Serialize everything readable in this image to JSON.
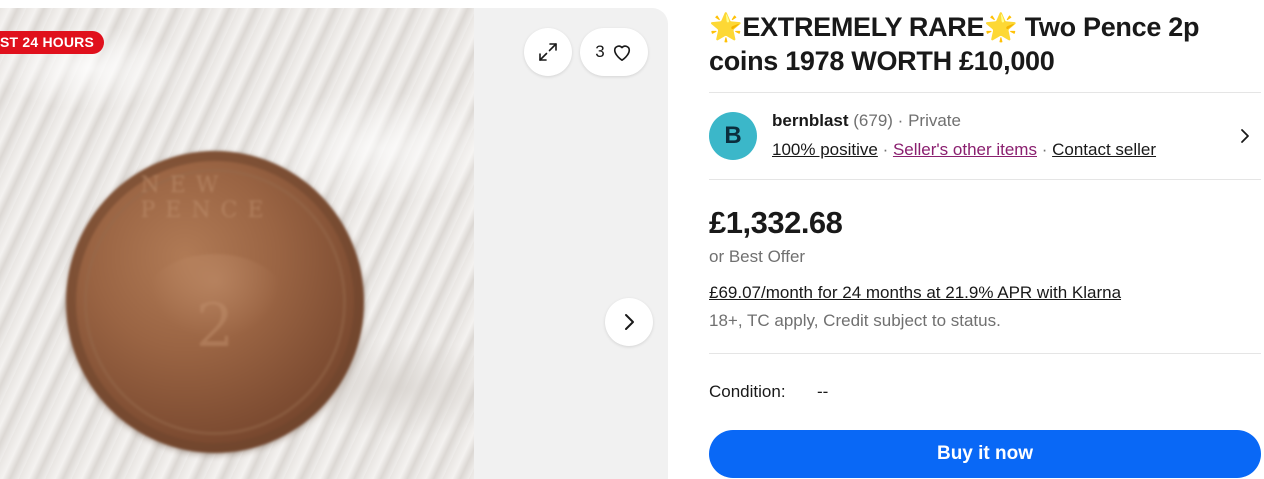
{
  "gallery": {
    "badge": "ST 24 HOURS",
    "watch_count": "3",
    "icons": {
      "expand": "expand-icon",
      "heart": "heart-icon",
      "next": "chevron-right-icon"
    }
  },
  "listing": {
    "title_prefix_emoji": "🌟",
    "title_rare": "EXTREMELY RARE",
    "title_suffix_emoji": "🌟",
    "title_rest": " Two Pence 2p coins 1978 WORTH £10,000"
  },
  "seller": {
    "avatar_letter": "B",
    "avatar_color": "#3bb7c9",
    "name": "bernblast",
    "feedback_count": "(679)",
    "separator": " · ",
    "type": "Private",
    "positive": "100% positive",
    "other_items": "Seller's other items",
    "contact": "Contact seller"
  },
  "pricing": {
    "price": "£1,332.68",
    "best_offer": "or Best Offer",
    "klarna": "£69.07/month for 24 months at 21.9% APR with Klarna",
    "terms": "18+, TC apply, Credit subject to status."
  },
  "condition": {
    "label": "Condition:",
    "value": "--"
  },
  "actions": {
    "buy_now": "Buy it now",
    "buy_color": "#0968f6"
  },
  "colors": {
    "badge_red": "#e0101c",
    "link_purple": "#8a1f6f"
  }
}
